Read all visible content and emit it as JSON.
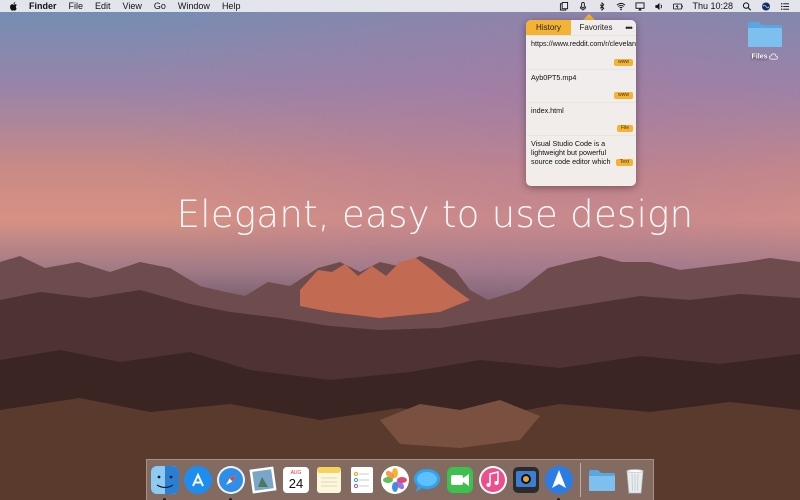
{
  "menubar": {
    "app_name": "Finder",
    "items": [
      "File",
      "Edit",
      "View",
      "Go",
      "Window",
      "Help"
    ],
    "status_icons": [
      "clipboard-app-icon",
      "microphone-icon",
      "bluetooth-icon",
      "wifi-icon",
      "airplay-icon",
      "volume-icon",
      "battery-icon"
    ],
    "clock": "Thu 10:28"
  },
  "headline": "Elegant, easy to use design",
  "popover": {
    "tabs": {
      "history": "History",
      "favorites": "Favorites",
      "more": "•••"
    },
    "active_tab": "History",
    "entries": [
      {
        "text": "https://www.reddit.com/r/clevelandcavs/new/",
        "badge": "www"
      },
      {
        "text": "Ayb0PT5.mp4",
        "badge": "www"
      },
      {
        "text": "index.html",
        "badge": "File"
      },
      {
        "text": "Visual Studio Code is a lightweight but powerful source code editor which",
        "badge": "Text"
      }
    ]
  },
  "desktop": {
    "files_label": "Files"
  },
  "dock": {
    "items": [
      {
        "name": "finder",
        "running": true
      },
      {
        "name": "app-store",
        "running": false
      },
      {
        "name": "safari",
        "running": true
      },
      {
        "name": "preview",
        "running": false
      },
      {
        "name": "calendar",
        "month": "AUG",
        "day": "24",
        "running": false
      },
      {
        "name": "notes",
        "running": false
      },
      {
        "name": "reminders",
        "running": false
      },
      {
        "name": "photos",
        "running": false
      },
      {
        "name": "messages",
        "running": false
      },
      {
        "name": "facetime",
        "running": false
      },
      {
        "name": "itunes",
        "running": false
      },
      {
        "name": "photo-booth",
        "running": false
      },
      {
        "name": "navigation-app",
        "running": true
      },
      {
        "name": "downloads-folder",
        "running": false
      },
      {
        "name": "trash",
        "running": false
      }
    ]
  },
  "colors": {
    "accent": "#f5b335",
    "folder": "#6fb4e8"
  }
}
